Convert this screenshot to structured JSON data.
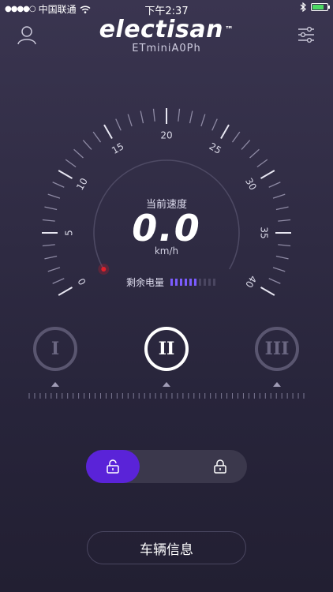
{
  "status_bar": {
    "signal_dots": "●●●●○",
    "carrier": "中国联通",
    "time": "下午2:37"
  },
  "header": {
    "logo": "electisan",
    "trademark": "™",
    "device_name": "ETminiA0Ph"
  },
  "gauge": {
    "tick_labels": [
      "0",
      "5",
      "10",
      "15",
      "20",
      "25",
      "30",
      "35",
      "40"
    ],
    "min": 0,
    "max": 40,
    "needle_value": 0,
    "accent_color": "#e0202a"
  },
  "speed": {
    "label": "当前速度",
    "value": "0.0",
    "unit": "km/h"
  },
  "battery": {
    "label": "剩余电量",
    "total_segments": 10,
    "filled_segments": 6,
    "filled_color": "#7b5cff",
    "empty_color": "#4a4660"
  },
  "modes": {
    "items": [
      {
        "label": "I"
      },
      {
        "label": "II"
      },
      {
        "label": "III"
      }
    ],
    "active_index": 1
  },
  "lock": {
    "state": "unlocked",
    "knob_color": "#5a23d8"
  },
  "actions": {
    "vehicle_info_label": "车辆信息"
  },
  "icons": {
    "user": "user-icon",
    "settings": "settings-icon",
    "unlock": "unlock-icon",
    "lock": "lock-icon"
  }
}
